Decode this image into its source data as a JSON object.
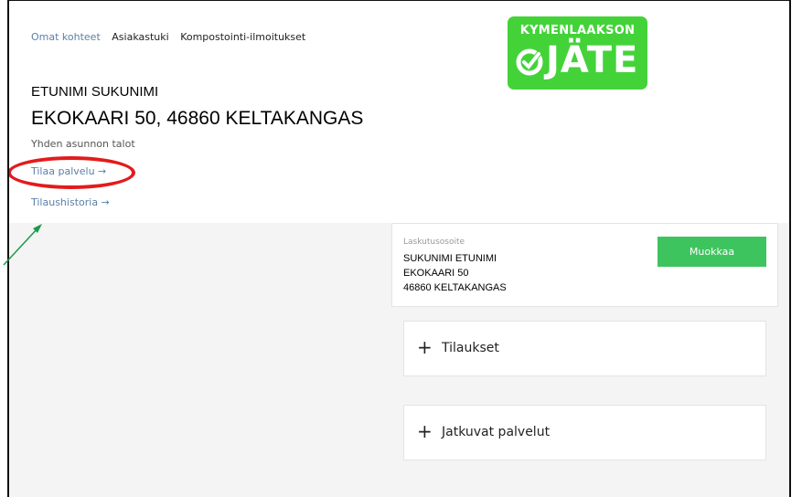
{
  "nav": {
    "items": [
      {
        "label": "Omat kohteet",
        "active": true
      },
      {
        "label": "Asiakastuki",
        "active": false
      },
      {
        "label": "Kompostointi-ilmoitukset",
        "active": false
      }
    ]
  },
  "logo": {
    "line1": "KYMENLAAKSON",
    "line2": "JÄTE"
  },
  "property": {
    "owner": "ETUNIMI SUKUNIMI",
    "address": "EKOKAARI 50, 46860 KELTAKANGAS",
    "type": "Yhden asunnon talot"
  },
  "links": {
    "order_service": "Tilaa palvelu →",
    "order_history": "Tilaushistoria →"
  },
  "billing": {
    "label": "Laskutusosoite",
    "name": "SUKUNIMI ETUNIMI",
    "street": "EKOKAARI 50",
    "city": "46860 KELTAKANGAS",
    "edit_button": "Muokkaa"
  },
  "panels": {
    "orders": "Tilaukset",
    "continuous": "Jatkuvat palvelut"
  },
  "colors": {
    "accent": "#3ec45f",
    "logo": "#43d339",
    "link": "#5b7fa8",
    "annotation_circle": "#e31b1b",
    "annotation_arrow": "#1a9a4a"
  }
}
